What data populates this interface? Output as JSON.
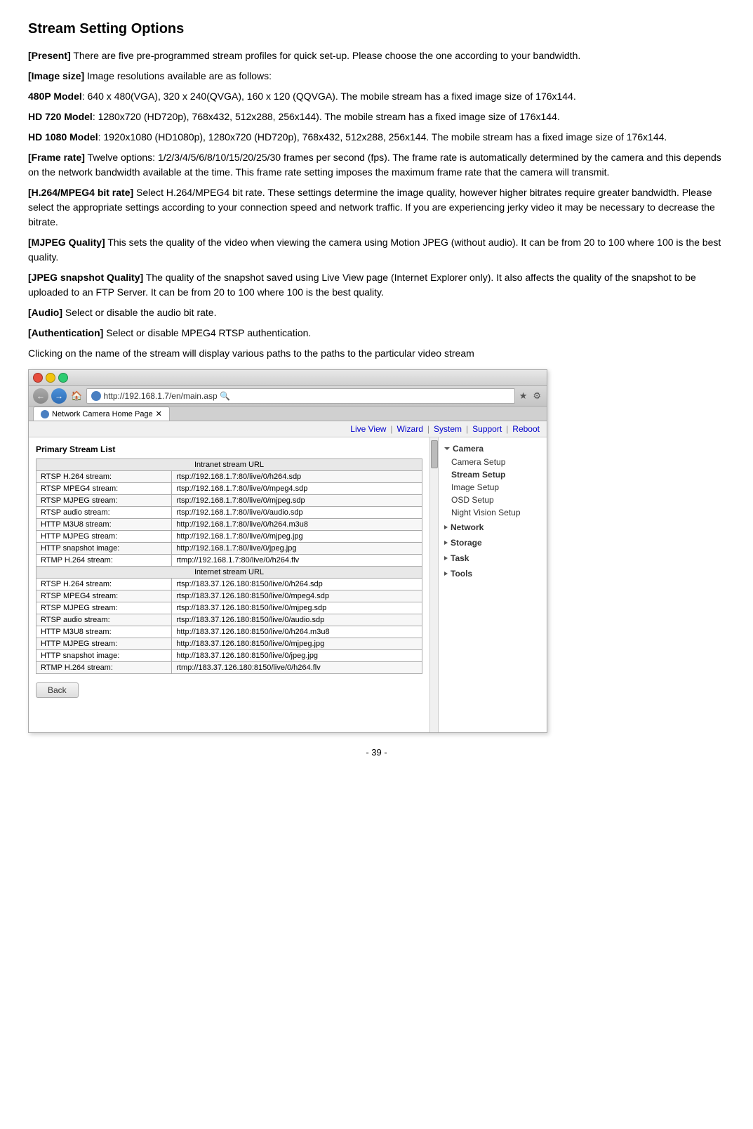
{
  "title": "Stream Setting Options",
  "paragraphs": [
    {
      "id": "p1",
      "boldPart": "[Present]",
      "text": " There are five pre-programmed stream profiles for quick set-up. Please choose the one according to your bandwidth."
    },
    {
      "id": "p2",
      "boldPart": "[Image size]",
      "text": " Image resolutions available are as follows:"
    },
    {
      "id": "p3",
      "boldPart": "480P Model",
      "text": ": 640 x 480(VGA), 320 x 240(QVGA), 160 x 120 (QQVGA). The mobile stream has a fixed image size of 176x144."
    },
    {
      "id": "p4",
      "boldPart": "HD 720 Model",
      "text": ": 1280x720 (HD720p), 768x432, 512x288, 256x144). The mobile stream has a fixed image size of 176x144."
    },
    {
      "id": "p5",
      "boldPart": "HD 1080 Model",
      "text": ": 1920x1080 (HD1080p), 1280x720 (HD720p), 768x432, 512x288, 256x144. The mobile stream has a fixed image size of 176x144."
    },
    {
      "id": "p6",
      "boldPart": "[Frame rate]",
      "text": " Twelve options: 1/2/3/4/5/6/8/10/15/20/25/30 frames per second (fps). The frame rate is automatically determined by the camera and this depends on the network bandwidth available at the time. This frame rate setting imposes the maximum frame rate that the camera will transmit."
    },
    {
      "id": "p7",
      "boldPart": "[H.264/MPEG4 bit rate]",
      "boldSuffix": " Select H.264/MPEG4 bit rate.",
      "text": " These settings determine the image quality, however higher bitrates require greater bandwidth. Please select the appropriate settings according to your connection speed and network traffic. If you are experiencing jerky video it may be necessary to decrease the bitrate."
    },
    {
      "id": "p8",
      "boldPart": "[MJPEG Quality]",
      "text": " This sets the quality of the video when viewing the camera using Motion JPEG (without audio). It can be from 20 to 100 where 100 is the best quality."
    },
    {
      "id": "p9",
      "boldPart": "[JPEG snapshot Quality]",
      "text": " The quality of the snapshot saved using Live View page (Internet Explorer only). It also affects the quality of the snapshot to be uploaded to an FTP Server. It can be from 20 to 100 where 100 is the best quality."
    },
    {
      "id": "p10",
      "boldPart": "[Audio]",
      "text": " Select or disable the audio bit rate."
    },
    {
      "id": "p11",
      "boldPart": "[Authentication]",
      "text": " Select or disable MPEG4 RTSP authentication."
    },
    {
      "id": "p12",
      "boldPart": "",
      "text": "Clicking on the name of the stream will display various paths to the paths to the particular video stream"
    }
  ],
  "browser": {
    "url": "http://192.168.1.7/en/main.asp",
    "tabTitle": "Network Camera Home Page",
    "tabClose": "×",
    "topbarLinks": [
      "Live View",
      "Wizard",
      "System",
      "Support",
      "Reboot"
    ],
    "sidebar": {
      "camera": {
        "header": "Camera",
        "items": [
          "Camera Setup",
          "Stream Setup",
          "Image Setup",
          "OSD Setup",
          "Night Vision Setup"
        ]
      },
      "network": {
        "header": "Network"
      },
      "storage": {
        "header": "Storage"
      },
      "task": {
        "header": "Task"
      },
      "tools": {
        "header": "Tools"
      }
    },
    "streamTable": {
      "title": "Primary Stream List",
      "intranetHeader": "Intranet stream URL",
      "intranetRows": [
        {
          "label": "RTSP H.264 stream:",
          "url": "rtsp://192.168.1.7:80/live/0/h264.sdp"
        },
        {
          "label": "RTSP MPEG4 stream:",
          "url": "rtsp://192.168.1.7:80/live/0/mpeg4.sdp"
        },
        {
          "label": "RTSP MJPEG stream:",
          "url": "rtsp://192.168.1.7:80/live/0/mjpeg.sdp"
        },
        {
          "label": "RTSP audio stream:",
          "url": "rtsp://192.168.1.7:80/live/0/audio.sdp"
        },
        {
          "label": "HTTP M3U8 stream:",
          "url": "http://192.168.1.7:80/live/0/h264.m3u8"
        },
        {
          "label": "HTTP MJPEG stream:",
          "url": "http://192.168.1.7:80/live/0/mjpeg.jpg"
        },
        {
          "label": "HTTP snapshot image:",
          "url": "http://192.168.1.7:80/live/0/jpeg.jpg"
        },
        {
          "label": "RTMP H.264 stream:",
          "url": "rtmp://192.168.1.7:80/live/0/h264.flv"
        }
      ],
      "internetHeader": "Internet stream URL",
      "internetRows": [
        {
          "label": "RTSP H.264 stream:",
          "url": "rtsp://183.37.126.180:8150/live/0/h264.sdp"
        },
        {
          "label": "RTSP MPEG4 stream:",
          "url": "rtsp://183.37.126.180:8150/live/0/mpeg4.sdp"
        },
        {
          "label": "RTSP MJPEG stream:",
          "url": "rtsp://183.37.126.180:8150/live/0/mjpeg.sdp"
        },
        {
          "label": "RTSP audio stream:",
          "url": "rtsp://183.37.126.180:8150/live/0/audio.sdp"
        },
        {
          "label": "HTTP M3U8 stream:",
          "url": "http://183.37.126.180:8150/live/0/h264.m3u8"
        },
        {
          "label": "HTTP MJPEG stream:",
          "url": "http://183.37.126.180:8150/live/0/mjpeg.jpg"
        },
        {
          "label": "HTTP snapshot image:",
          "url": "http://183.37.126.180:8150/live/0/jpeg.jpg"
        },
        {
          "label": "RTMP H.264 stream:",
          "url": "rtmp://183.37.126.180:8150/live/0/h264.flv"
        }
      ],
      "backButton": "Back"
    }
  },
  "footer": {
    "pageNumber": "- 39 -"
  }
}
